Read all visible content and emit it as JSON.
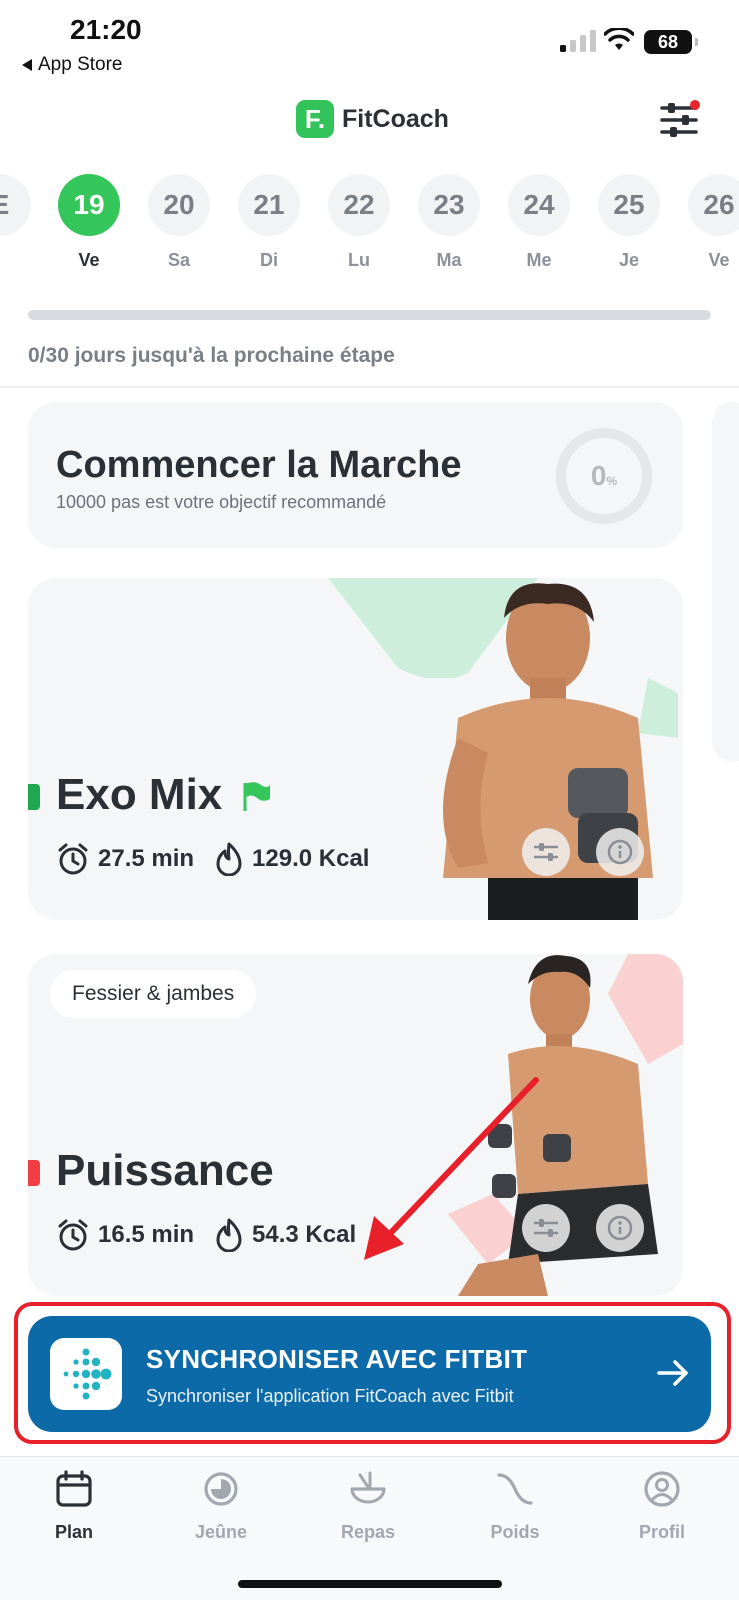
{
  "status_bar": {
    "time": "21:20",
    "back_label": "App Store",
    "battery": "68"
  },
  "header": {
    "app_name": "FitCoach",
    "logo_letter": "F."
  },
  "days": [
    {
      "num": "E",
      "label": ""
    },
    {
      "num": "19",
      "label": "Ve",
      "active": true
    },
    {
      "num": "20",
      "label": "Sa"
    },
    {
      "num": "21",
      "label": "Di"
    },
    {
      "num": "22",
      "label": "Lu"
    },
    {
      "num": "23",
      "label": "Ma"
    },
    {
      "num": "24",
      "label": "Me"
    },
    {
      "num": "25",
      "label": "Je"
    },
    {
      "num": "26",
      "label": "Ve"
    }
  ],
  "milestone": {
    "progress": 0,
    "text": "0/30 jours jusqu'à la prochaine étape"
  },
  "walk": {
    "title": "Commencer la Marche",
    "subtitle": "10000 pas est votre objectif recommandé",
    "percent": "0",
    "percent_unit": "%"
  },
  "workouts": [
    {
      "name": "Exo Mix",
      "duration": "27.5 min",
      "calories": "129.0 Kcal",
      "accent": "#1fa84f",
      "tag": ""
    },
    {
      "name": "Puissance",
      "duration": "16.5 min",
      "calories": "54.3 Kcal",
      "accent": "#f23d43",
      "tag": "Fessier & jambes"
    }
  ],
  "sync": {
    "title": "SYNCHRONISER AVEC FITBIT",
    "subtitle": "Synchroniser l'application FitCoach avec Fitbit"
  },
  "tabs": [
    {
      "label": "Plan",
      "icon": "calendar-icon",
      "active": true
    },
    {
      "label": "Jeûne",
      "icon": "fasting-icon"
    },
    {
      "label": "Repas",
      "icon": "meal-bowl-icon"
    },
    {
      "label": "Poids",
      "icon": "weight-curve-icon"
    },
    {
      "label": "Profil",
      "icon": "profile-icon"
    }
  ],
  "colors": {
    "accent_green": "#35c65b",
    "fitbit_blue": "#0d6aa8",
    "annotation_red": "#e8202a"
  }
}
